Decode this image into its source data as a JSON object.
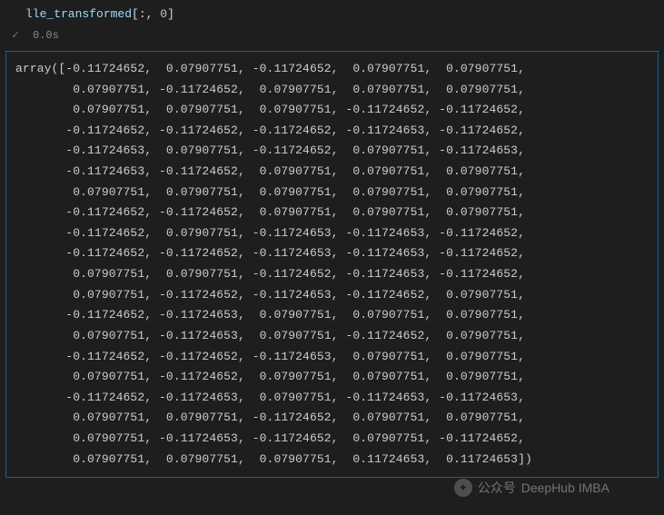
{
  "cell": {
    "code_tokens": {
      "var": "lle_transformed",
      "open": "[",
      "colon": ":",
      "comma": ", ",
      "index": "0",
      "close": "]"
    },
    "status": {
      "icon": "✓",
      "time": "0.0s"
    },
    "output_lines": [
      "array([-0.11724652,  0.07907751, -0.11724652,  0.07907751,  0.07907751,",
      "        0.07907751, -0.11724652,  0.07907751,  0.07907751,  0.07907751,",
      "        0.07907751,  0.07907751,  0.07907751, -0.11724652, -0.11724652,",
      "       -0.11724652, -0.11724652, -0.11724652, -0.11724653, -0.11724652,",
      "       -0.11724653,  0.07907751, -0.11724652,  0.07907751, -0.11724653,",
      "       -0.11724653, -0.11724652,  0.07907751,  0.07907751,  0.07907751,",
      "        0.07907751,  0.07907751,  0.07907751,  0.07907751,  0.07907751,",
      "       -0.11724652, -0.11724652,  0.07907751,  0.07907751,  0.07907751,",
      "       -0.11724652,  0.07907751, -0.11724653, -0.11724653, -0.11724652,",
      "       -0.11724652, -0.11724652, -0.11724653, -0.11724653, -0.11724652,",
      "        0.07907751,  0.07907751, -0.11724652, -0.11724653, -0.11724652,",
      "        0.07907751, -0.11724652, -0.11724653, -0.11724652,  0.07907751,",
      "       -0.11724652, -0.11724653,  0.07907751,  0.07907751,  0.07907751,",
      "        0.07907751, -0.11724653,  0.07907751, -0.11724652,  0.07907751,",
      "       -0.11724652, -0.11724652, -0.11724653,  0.07907751,  0.07907751,",
      "        0.07907751, -0.11724652,  0.07907751,  0.07907751,  0.07907751,",
      "       -0.11724652, -0.11724653,  0.07907751, -0.11724653, -0.11724653,",
      "        0.07907751,  0.07907751, -0.11724652,  0.07907751,  0.07907751,",
      "        0.07907751, -0.11724653, -0.11724652,  0.07907751, -0.11724652,",
      "        0.07907751,  0.07907751,  0.07907751,  0.11724653,  0.11724653])"
    ]
  },
  "watermark": {
    "prefix": "公众号",
    "text": "DeepHub IMBA"
  }
}
